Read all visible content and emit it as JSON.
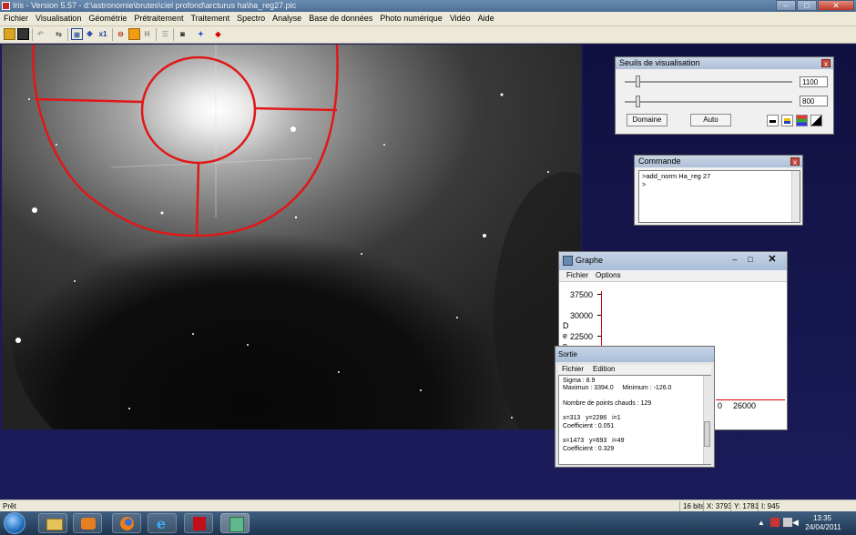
{
  "window": {
    "title": "Iris - Version 5.57 - d:\\astronomie\\brutes\\ciel profond\\arcturus ha\\ha_reg27.pic"
  },
  "menu": [
    "Fichier",
    "Visualisation",
    "Géométrie",
    "Prétraitement",
    "Traitement",
    "Spectro",
    "Analyse",
    "Base de données",
    "Photo numérique",
    "Vidéo",
    "Aide"
  ],
  "toolbar": {
    "icons": [
      "open-icon",
      "save-icon",
      "undo-icon",
      "swap-icon",
      "grid-icon",
      "move-icon",
      "x1-icon",
      "scope-icon",
      "square-icon",
      "h-icon",
      "list-icon",
      "camera-icon",
      "crosshair-icon",
      "red-dot-icon"
    ],
    "x1_label": "x1",
    "h_label": "H"
  },
  "seuils": {
    "title": "Seuils de visualisation",
    "high_value": "1100",
    "low_value": "800",
    "domaine_label": "Domaine",
    "auto_label": "Auto"
  },
  "commande": {
    "title": "Commande",
    "text": ">add_norm Ha_reg 27\n>"
  },
  "graphe": {
    "title": "Graphe",
    "menu": [
      "Fichier",
      "Options"
    ],
    "y_ticks": [
      "37500",
      "30000",
      "22500"
    ],
    "y_label_chars": [
      "D",
      "e",
      "n"
    ],
    "x_tick_partial": "0",
    "x_tick": "26000"
  },
  "sortie": {
    "title": "Sortie",
    "menu": [
      "Fichier",
      "Edition"
    ],
    "lines": [
      "Sigma : 8.9",
      "Maximun : 3394.0     Minimum : -126.0",
      "",
      "Nombre de points chauds : 129",
      "",
      "x=313   y=2286   i=1",
      "Coefficient : 0.051",
      "",
      "x=1473   y=693   i=49",
      "Coefficient : 0.329"
    ]
  },
  "status": {
    "left": "Prêt",
    "bits": "16 bits",
    "x": "X: 3793",
    "y": "Y: 1781",
    "i": "I: 945"
  },
  "taskbar": {
    "time": "13:35",
    "date": "24/04/2011",
    "apps": [
      "explorer-icon",
      "media-player-icon",
      "firefox-icon",
      "ie-icon",
      "acrobat-icon",
      "iris-icon"
    ]
  }
}
